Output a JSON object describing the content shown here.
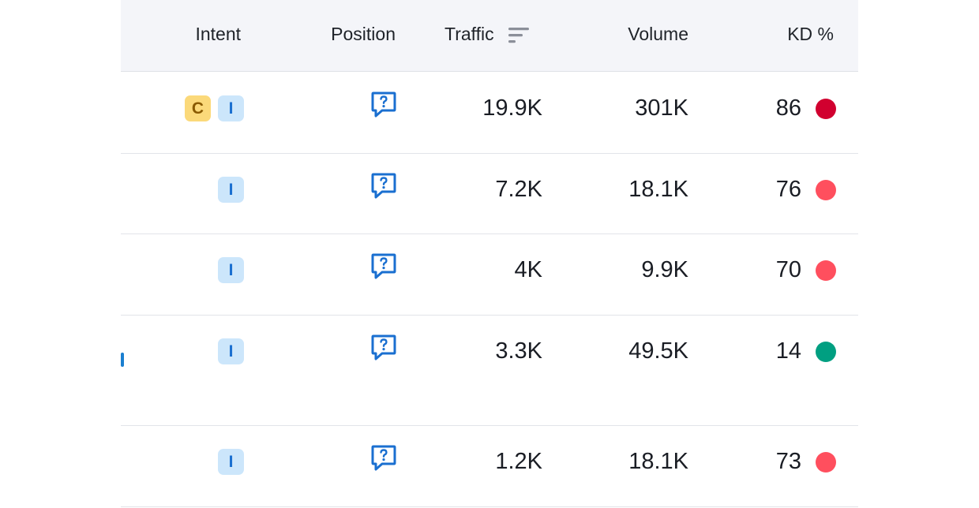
{
  "header": {
    "intent": "Intent",
    "position": "Position",
    "traffic": "Traffic",
    "volume": "Volume",
    "kd": "KD %",
    "traffic_sort_icon": "sort-descending-icon"
  },
  "rows": [
    {
      "intents": [
        "C",
        "I"
      ],
      "position_icon": "serp-feature-question-icon",
      "traffic": "19.9K",
      "volume": "301K",
      "kd": "86",
      "kd_color": "#d1002f"
    },
    {
      "intents": [
        "I"
      ],
      "position_icon": "serp-feature-question-icon",
      "traffic": "7.2K",
      "volume": "18.1K",
      "kd": "76",
      "kd_color": "#ff4f5e"
    },
    {
      "intents": [
        "I"
      ],
      "position_icon": "serp-feature-question-icon",
      "traffic": "4K",
      "volume": "9.9K",
      "kd": "70",
      "kd_color": "#ff4f5e"
    },
    {
      "intents": [
        "I"
      ],
      "position_icon": "serp-feature-question-icon",
      "traffic": "3.3K",
      "volume": "49.5K",
      "kd": "14",
      "kd_color": "#009f81"
    },
    {
      "intents": [
        "I"
      ],
      "position_icon": "serp-feature-question-icon",
      "traffic": "1.2K",
      "volume": "18.1K",
      "kd": "73",
      "kd_color": "#ff4f5e"
    }
  ]
}
